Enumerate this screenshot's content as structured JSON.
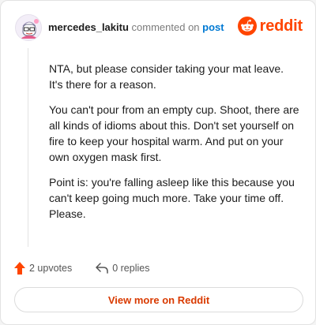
{
  "header": {
    "username": "mercedes_lakitu",
    "commented_on": "commented on",
    "post_link": "post"
  },
  "brand": {
    "name": "reddit",
    "color": "#ff4500"
  },
  "comment": {
    "paragraphs": [
      "NTA, but please consider taking your mat leave. It's there for a reason.",
      "You can't pour from an empty cup. Shoot, there are all kinds of idioms about this. Don't set yourself on fire to keep your hospital warm. And put on your own oxygen mask first.",
      "Point is: you're falling asleep like this because you can't keep going much more. Take your time off. Please."
    ]
  },
  "actions": {
    "upvotes": "2 upvotes",
    "replies": "0 replies",
    "upvote_icon": "upvote-arrow-icon",
    "reply_icon": "reply-arrow-icon"
  },
  "footer": {
    "view_more": "View more on Reddit"
  }
}
